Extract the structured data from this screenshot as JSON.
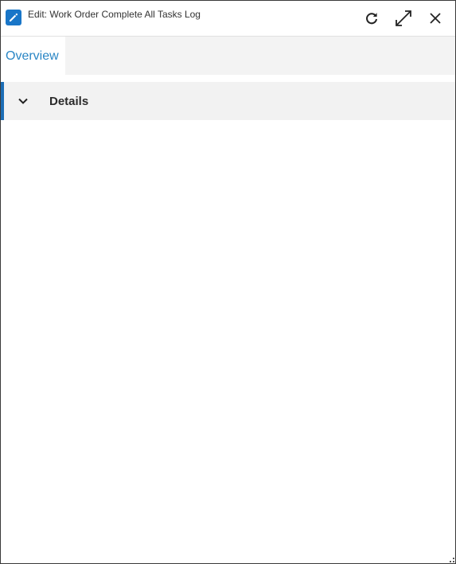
{
  "window": {
    "title": "Edit: Work Order Complete All Tasks Log",
    "icon": "edit-pencil-icon",
    "buttons": {
      "refresh": "refresh-icon",
      "maximize": "maximize-icon",
      "close": "close-icon"
    }
  },
  "tabs": [
    {
      "label": "Overview",
      "active": true
    }
  ],
  "sections": [
    {
      "title": "Details",
      "expanded": true
    }
  ],
  "colors": {
    "accent": "#1c6db5",
    "tab_text": "#2a86c5",
    "icon_bg": "#1976c8"
  }
}
